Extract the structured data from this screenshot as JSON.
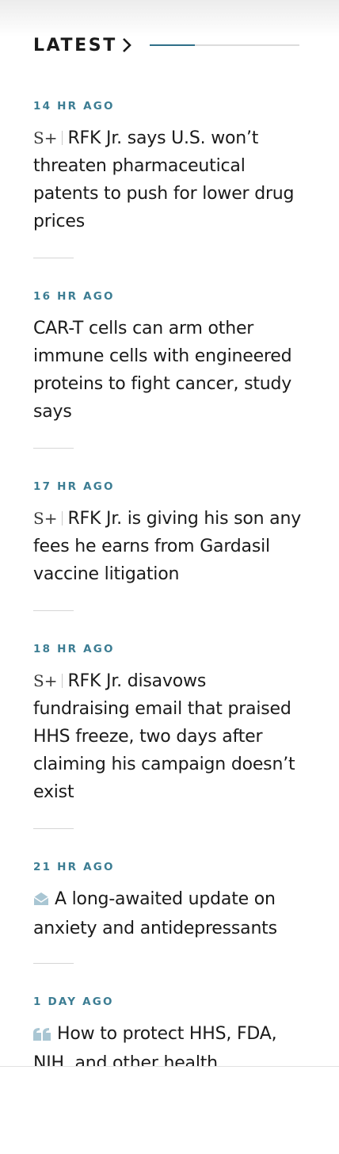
{
  "section": {
    "title": "LATEST",
    "carousel_progress": 0.3
  },
  "stories": [
    {
      "time": "14 HR AGO",
      "badge": "S+",
      "headline": "RFK Jr. says U.S. won’t threaten pharmaceutical patents to push for lower drug prices"
    },
    {
      "time": "16 HR AGO",
      "badge": "",
      "headline": "CAR-T cells can arm other immune cells with engineered proteins to fight cancer, study says"
    },
    {
      "time": "17 HR AGO",
      "badge": "S+",
      "headline": "RFK Jr. is giving his son any fees he earns from Gardasil vaccine litigation"
    },
    {
      "time": "18 HR AGO",
      "badge": "S+",
      "headline": "RFK Jr. disavows fundraising email that praised HHS freeze, two days after claiming his campaign doesn’t exist"
    },
    {
      "time": "21 HR AGO",
      "badge": "newsletter",
      "headline": "A long-awaited update on anxiety and antidepressants"
    },
    {
      "time": "1 DAY AGO",
      "badge": "opinion",
      "headline": "How to protect HHS, FDA, NIH, and other health"
    }
  ],
  "colors": {
    "timestamp": "#3c7d93",
    "accent": "#2f6f88",
    "icon": "#a9c6d3"
  }
}
